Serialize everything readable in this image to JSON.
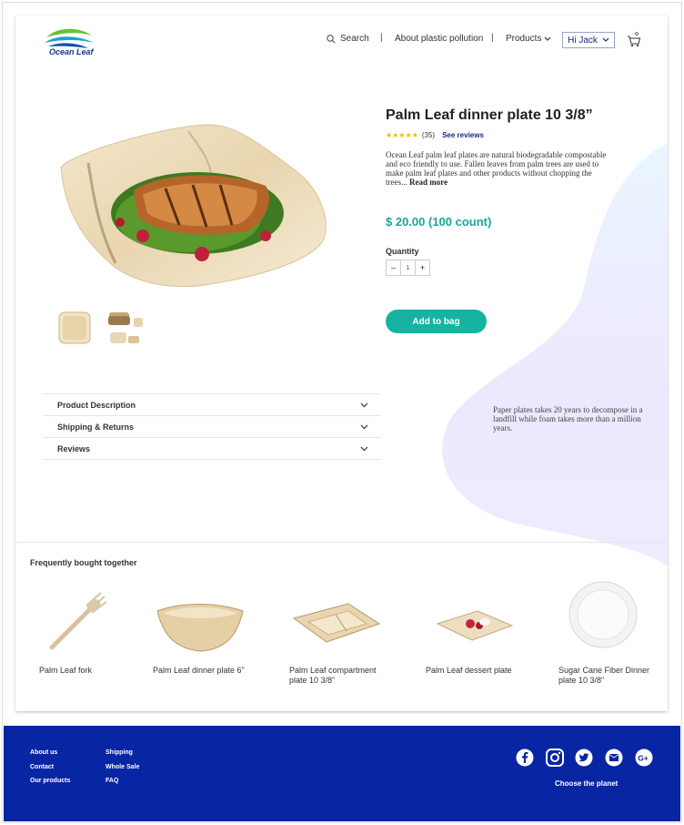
{
  "header": {
    "logo_text": "Ocean Leaf",
    "search_label": "Search",
    "separator": "|",
    "about_label": "About plastic pollution",
    "products_label": "Products",
    "user_label": "Hi Jack"
  },
  "product": {
    "title": "Palm Leaf dinner plate  10 3/8”",
    "stars": "★★★★★",
    "review_count": "(35)",
    "see_reviews": "See reviews",
    "description": "Ocean Leaf palm leaf plates are natural biodegradable compostable and eco friendly to use. Fallen leaves from palm trees are used to make palm leaf plates and other products without chopping the trees...",
    "read_more": "Read more",
    "price": "$ 20.00 (100 count)",
    "quantity_label": "Quantity",
    "qty_minus": "–",
    "qty_value": "1",
    "qty_plus": "+",
    "add_to_bag": "Add to bag"
  },
  "accordion": [
    {
      "label": "Product Description"
    },
    {
      "label": "Shipping & Returns"
    },
    {
      "label": "Reviews"
    }
  ],
  "fact": "Paper plates takes 20 years to decompose in a landfill while foam takes more than a million years.",
  "frequently_bought": {
    "title": "Frequently bought together",
    "items": [
      {
        "name": "Palm Leaf fork"
      },
      {
        "name": "Palm Leaf dinner plate 6”"
      },
      {
        "name": "Palm Leaf compartment plate  10 3/8”"
      },
      {
        "name": "Palm Leaf dessert plate"
      },
      {
        "name": "Sugar Cane Fiber Dinner plate 10 3/8”"
      }
    ]
  },
  "footer": {
    "col1": [
      "About us",
      "Contact",
      "Our products"
    ],
    "col2": [
      "Shipping",
      "Whole Sale",
      "FAQ"
    ],
    "social_icons": [
      "facebook-icon",
      "instagram-icon",
      "twitter-icon",
      "mail-icon",
      "google-plus-icon"
    ],
    "tagline": "Choose the planet"
  },
  "colors": {
    "accent_teal": "#16b3a2",
    "brand_blue": "#0826a3",
    "price_teal": "#15a79a",
    "star_yellow": "#f2b70a"
  }
}
